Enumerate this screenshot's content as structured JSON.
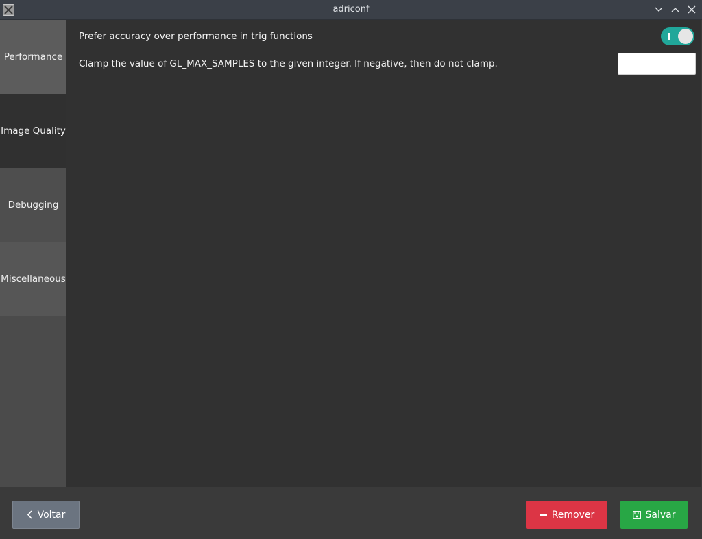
{
  "window": {
    "title": "adriconf",
    "app_icon": "x-app-icon",
    "controls": [
      "chevron-down-icon",
      "chevron-up-icon",
      "close-icon"
    ]
  },
  "sidebar": {
    "items": [
      {
        "label": "Performance"
      },
      {
        "label": "Image Quality"
      },
      {
        "label": "Debugging"
      },
      {
        "label": "Miscellaneous"
      }
    ],
    "active": "Image Quality"
  },
  "options": {
    "trig_accuracy": {
      "label": "Prefer accuracy over performance in trig functions",
      "enabled": true
    },
    "clamp_samples": {
      "label": "Clamp the value of GL_MAX_SAMPLES to the given integer. If negative, then do not clamp.",
      "value": ""
    }
  },
  "footer": {
    "back_label": "Voltar",
    "remove_label": "Remover",
    "save_label": "Salvar"
  },
  "colors": {
    "toggle_on": "#21a79a",
    "remove": "#dc3545",
    "save": "#28a745",
    "back": "#6b7480"
  }
}
